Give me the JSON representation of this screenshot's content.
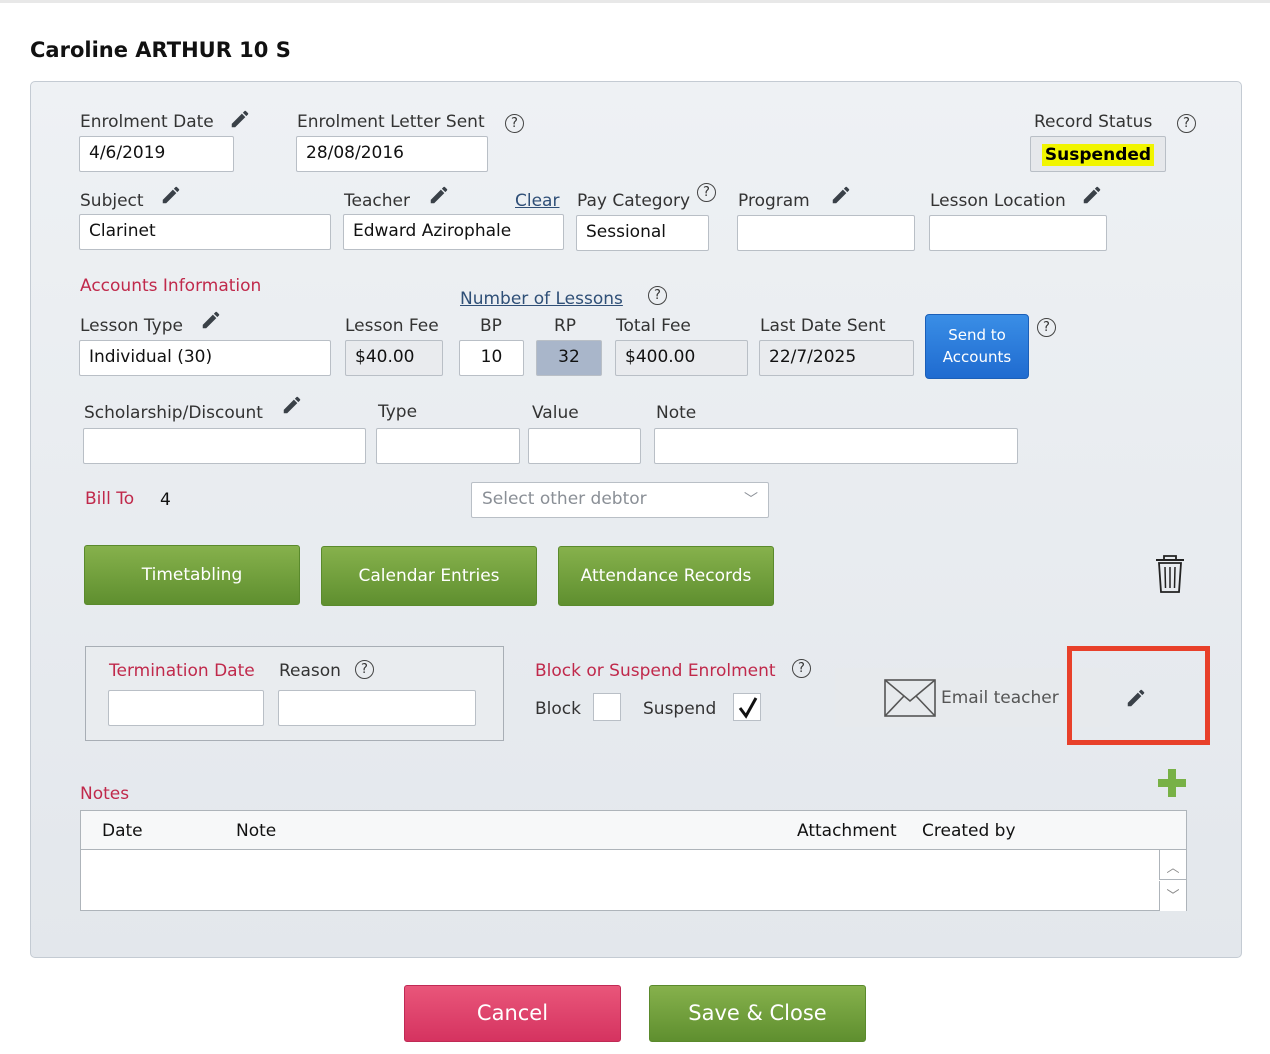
{
  "header": {
    "title": "Caroline ARTHUR 10 S"
  },
  "enrolment": {
    "enrolment_date_label": "Enrolment Date",
    "enrolment_date": "4/6/2019",
    "letter_sent_label": "Enrolment Letter Sent",
    "letter_sent": "28/08/2016",
    "record_status_label": "Record Status",
    "record_status": "Suspended",
    "subject_label": "Subject",
    "subject": "Clarinet",
    "teacher_label": "Teacher",
    "teacher": "Edward Azirophale",
    "clear_label": "Clear",
    "pay_category_label": "Pay Category",
    "pay_category": "Sessional",
    "program_label": "Program",
    "program": "",
    "lesson_location_label": "Lesson Location",
    "lesson_location": ""
  },
  "accounts": {
    "section_label": "Accounts Information",
    "number_of_lessons_label": "Number of Lessons",
    "lesson_type_label": "Lesson Type",
    "lesson_type": "Individual (30)",
    "lesson_fee_label": "Lesson Fee",
    "lesson_fee": "$40.00",
    "bp_label": "BP",
    "bp": "10",
    "rp_label": "RP",
    "rp": "32",
    "total_fee_label": "Total Fee",
    "total_fee": "$400.00",
    "last_date_sent_label": "Last Date Sent",
    "last_date_sent": "22/7/2025",
    "send_button_line1": "Send to",
    "send_button_line2": "Accounts",
    "scholarship_label": "Scholarship/Discount",
    "type_label": "Type",
    "value_label": "Value",
    "note_label": "Note",
    "bill_to_label": "Bill To",
    "bill_to": "4",
    "debtor_placeholder": "Select other debtor"
  },
  "actions": {
    "timetabling": "Timetabling",
    "calendar_entries": "Calendar Entries",
    "attendance_records": "Attendance Records"
  },
  "termination": {
    "date_label": "Termination Date",
    "reason_label": "Reason"
  },
  "block": {
    "section_label": "Block or Suspend Enrolment",
    "block_label": "Block",
    "block_checked": false,
    "suspend_label": "Suspend",
    "suspend_checked": true
  },
  "email": {
    "label": "Email teacher"
  },
  "notes": {
    "section_label": "Notes",
    "columns": [
      "Date",
      "Note",
      "Attachment",
      "Created by"
    ],
    "rows": []
  },
  "footer": {
    "cancel": "Cancel",
    "save": "Save & Close"
  },
  "icons": {
    "pencil": "pencil-icon",
    "help": "help-icon",
    "trash": "trash-icon",
    "envelope": "envelope-icon",
    "plus": "plus-icon"
  },
  "colors": {
    "section_red": "#c0294b",
    "green_button": "#6f9f3a",
    "blue_button": "#2a7ad9",
    "cancel_button": "#dc3f68",
    "highlight": "#e8402a",
    "status_badge": "#f1f500"
  }
}
